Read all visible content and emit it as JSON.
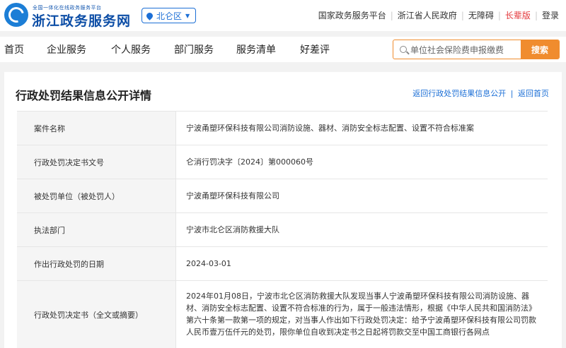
{
  "header": {
    "subtitle": "全国一体化在线政务服务平台",
    "site_name": "浙江政务服务网",
    "region": "北仑区",
    "links": [
      "国家政务服务平台",
      "浙江省人民政府",
      "无障碍",
      "长辈版",
      "登录"
    ]
  },
  "nav": {
    "items": [
      "首页",
      "企业服务",
      "个人服务",
      "部门服务",
      "服务清单",
      "好差评"
    ],
    "search_placeholder": "单位社会保险费申报缴费",
    "search_button": "搜索"
  },
  "page": {
    "title": "行政处罚结果信息公开详情",
    "back_link": "返回行政处罚结果信息公开",
    "home_link": "返回首页",
    "separator": "|"
  },
  "details": [
    {
      "label": "案件名称",
      "value": "宁波甬塑环保科技有限公司消防设施、器材、消防安全标志配置、设置不符合标准案"
    },
    {
      "label": "行政处罚决定书文号",
      "value": "仑消行罚决字〔2024〕第000060号"
    },
    {
      "label": "被处罚单位（被处罚人）",
      "value": "宁波甬塑环保科技有限公司"
    },
    {
      "label": "执法部门",
      "value": "宁波市北仑区消防救援大队"
    },
    {
      "label": "作出行政处罚的日期",
      "value": "2024-03-01"
    },
    {
      "label": "行政处罚决定书（全文或摘要）",
      "value": "2024年01月08日，宁波市北仑区消防救援大队发现当事人宁波甬塑环保科技有限公司消防设施、器材、消防安全标志配置、设置不符合标准的行为，属于一般违法情形，根据《中华人民共和国消防法》第六十条第一款第一项的规定，对当事人作出如下行政处罚决定：给予宁波甬塑环保科技有限公司罚款人民币壹万伍仟元的处罚，限你单位自收到决定书之日起将罚款交至中国工商银行各网点"
    }
  ]
}
